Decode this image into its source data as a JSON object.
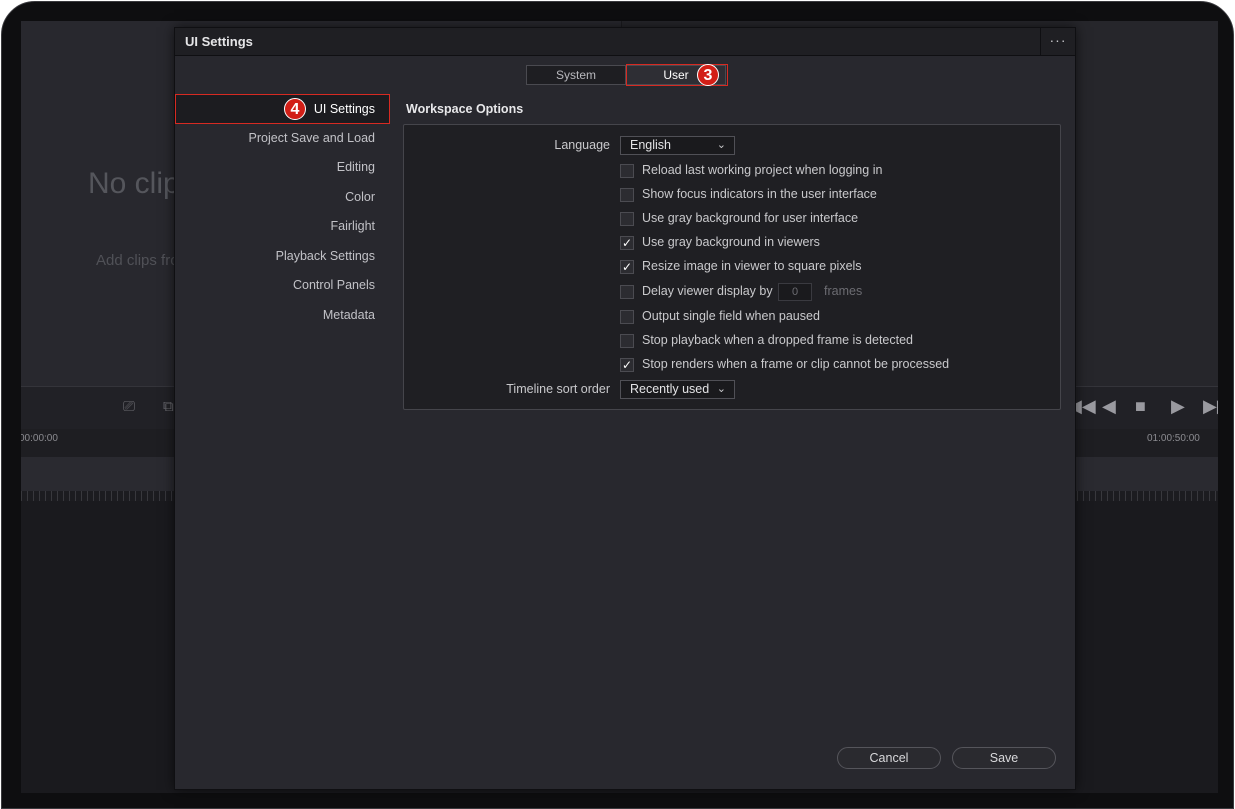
{
  "background": {
    "no_clip": "No clip",
    "add_clips": "Add clips fro",
    "timecode_start": "00:00:00",
    "timecode_end": "01:00:50:00",
    "transport": [
      "◀◀",
      "◀",
      "■",
      "▶",
      "▶▶"
    ]
  },
  "dialog": {
    "title": "UI Settings",
    "more_icon": "···",
    "tabs": [
      {
        "label": "System",
        "active": false
      },
      {
        "label": "User",
        "active": true
      }
    ],
    "annotations": {
      "user_tab": "3",
      "ui_settings": "4"
    },
    "annotation_color": "#d21f17",
    "sidebar": [
      {
        "label": "UI Settings",
        "active": true
      },
      {
        "label": "Project Save and Load"
      },
      {
        "label": "Editing"
      },
      {
        "label": "Color"
      },
      {
        "label": "Fairlight"
      },
      {
        "label": "Playback Settings"
      },
      {
        "label": "Control Panels"
      },
      {
        "label": "Metadata"
      }
    ],
    "section_title": "Workspace Options",
    "language": {
      "label": "Language",
      "value": "English"
    },
    "options": [
      {
        "label": "Reload last working project when logging in",
        "checked": false
      },
      {
        "label": "Show focus indicators in the user interface",
        "checked": false
      },
      {
        "label": "Use gray background for user interface",
        "checked": false
      },
      {
        "label": "Use gray background in viewers",
        "checked": true
      },
      {
        "label": "Resize image in viewer to square pixels",
        "checked": true
      },
      {
        "label": "Delay viewer display by",
        "checked": false,
        "value": "0",
        "unit": "frames"
      },
      {
        "label": "Output single field when paused",
        "checked": false
      },
      {
        "label": "Stop playback when a dropped frame is detected",
        "checked": false
      },
      {
        "label": "Stop renders when a frame or clip cannot be processed",
        "checked": true
      }
    ],
    "sort_order": {
      "label": "Timeline sort order",
      "value": "Recently used"
    },
    "buttons": {
      "cancel": "Cancel",
      "save": "Save"
    }
  }
}
